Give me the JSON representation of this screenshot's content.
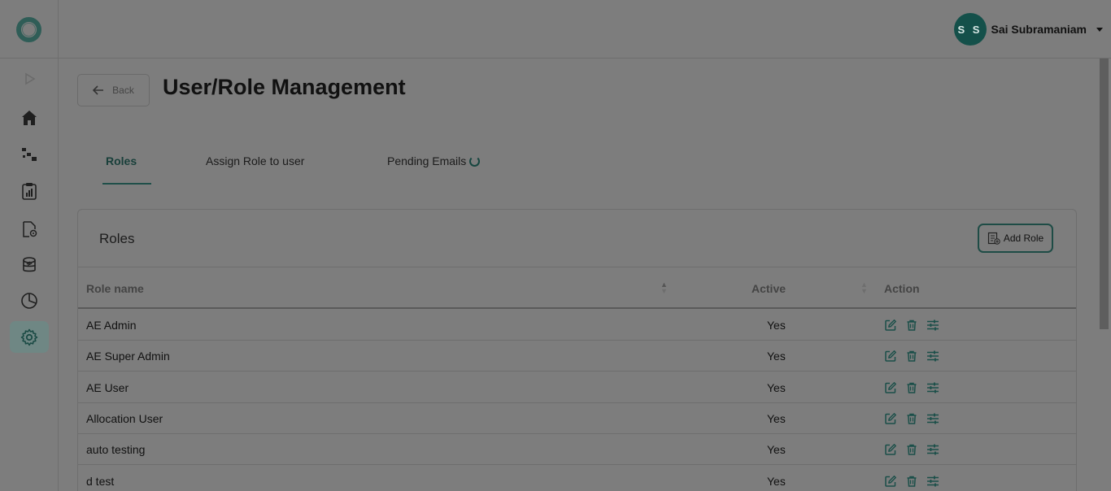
{
  "header": {
    "user_initials": "S S",
    "user_name": "Sai Subramaniam"
  },
  "page": {
    "back_label": "Back",
    "title": "User/Role Management"
  },
  "tabs": [
    {
      "label": "Roles",
      "active": true
    },
    {
      "label": "Assign Role to user",
      "active": false
    },
    {
      "label": "Pending Emails",
      "active": false
    }
  ],
  "card": {
    "title": "Roles",
    "add_button_label": "Add Role"
  },
  "table": {
    "columns": [
      "Role name",
      "Active",
      "Action"
    ],
    "rows": [
      {
        "name": "AE Admin",
        "active": "Yes"
      },
      {
        "name": "AE Super Admin",
        "active": "Yes"
      },
      {
        "name": "AE User",
        "active": "Yes"
      },
      {
        "name": "Allocation User",
        "active": "Yes"
      },
      {
        "name": "auto testing",
        "active": "Yes"
      },
      {
        "name": "d test",
        "active": "Yes"
      }
    ]
  },
  "sidebar": {
    "items": [
      "expand-icon",
      "home-icon",
      "workflow-icon",
      "report-icon",
      "document-settings-icon",
      "database-icon",
      "pie-chart-icon",
      "settings-icon"
    ],
    "active_item": "settings-icon"
  },
  "colors": {
    "accent": "#14504a",
    "overlay_background": "#7d7d7d"
  }
}
